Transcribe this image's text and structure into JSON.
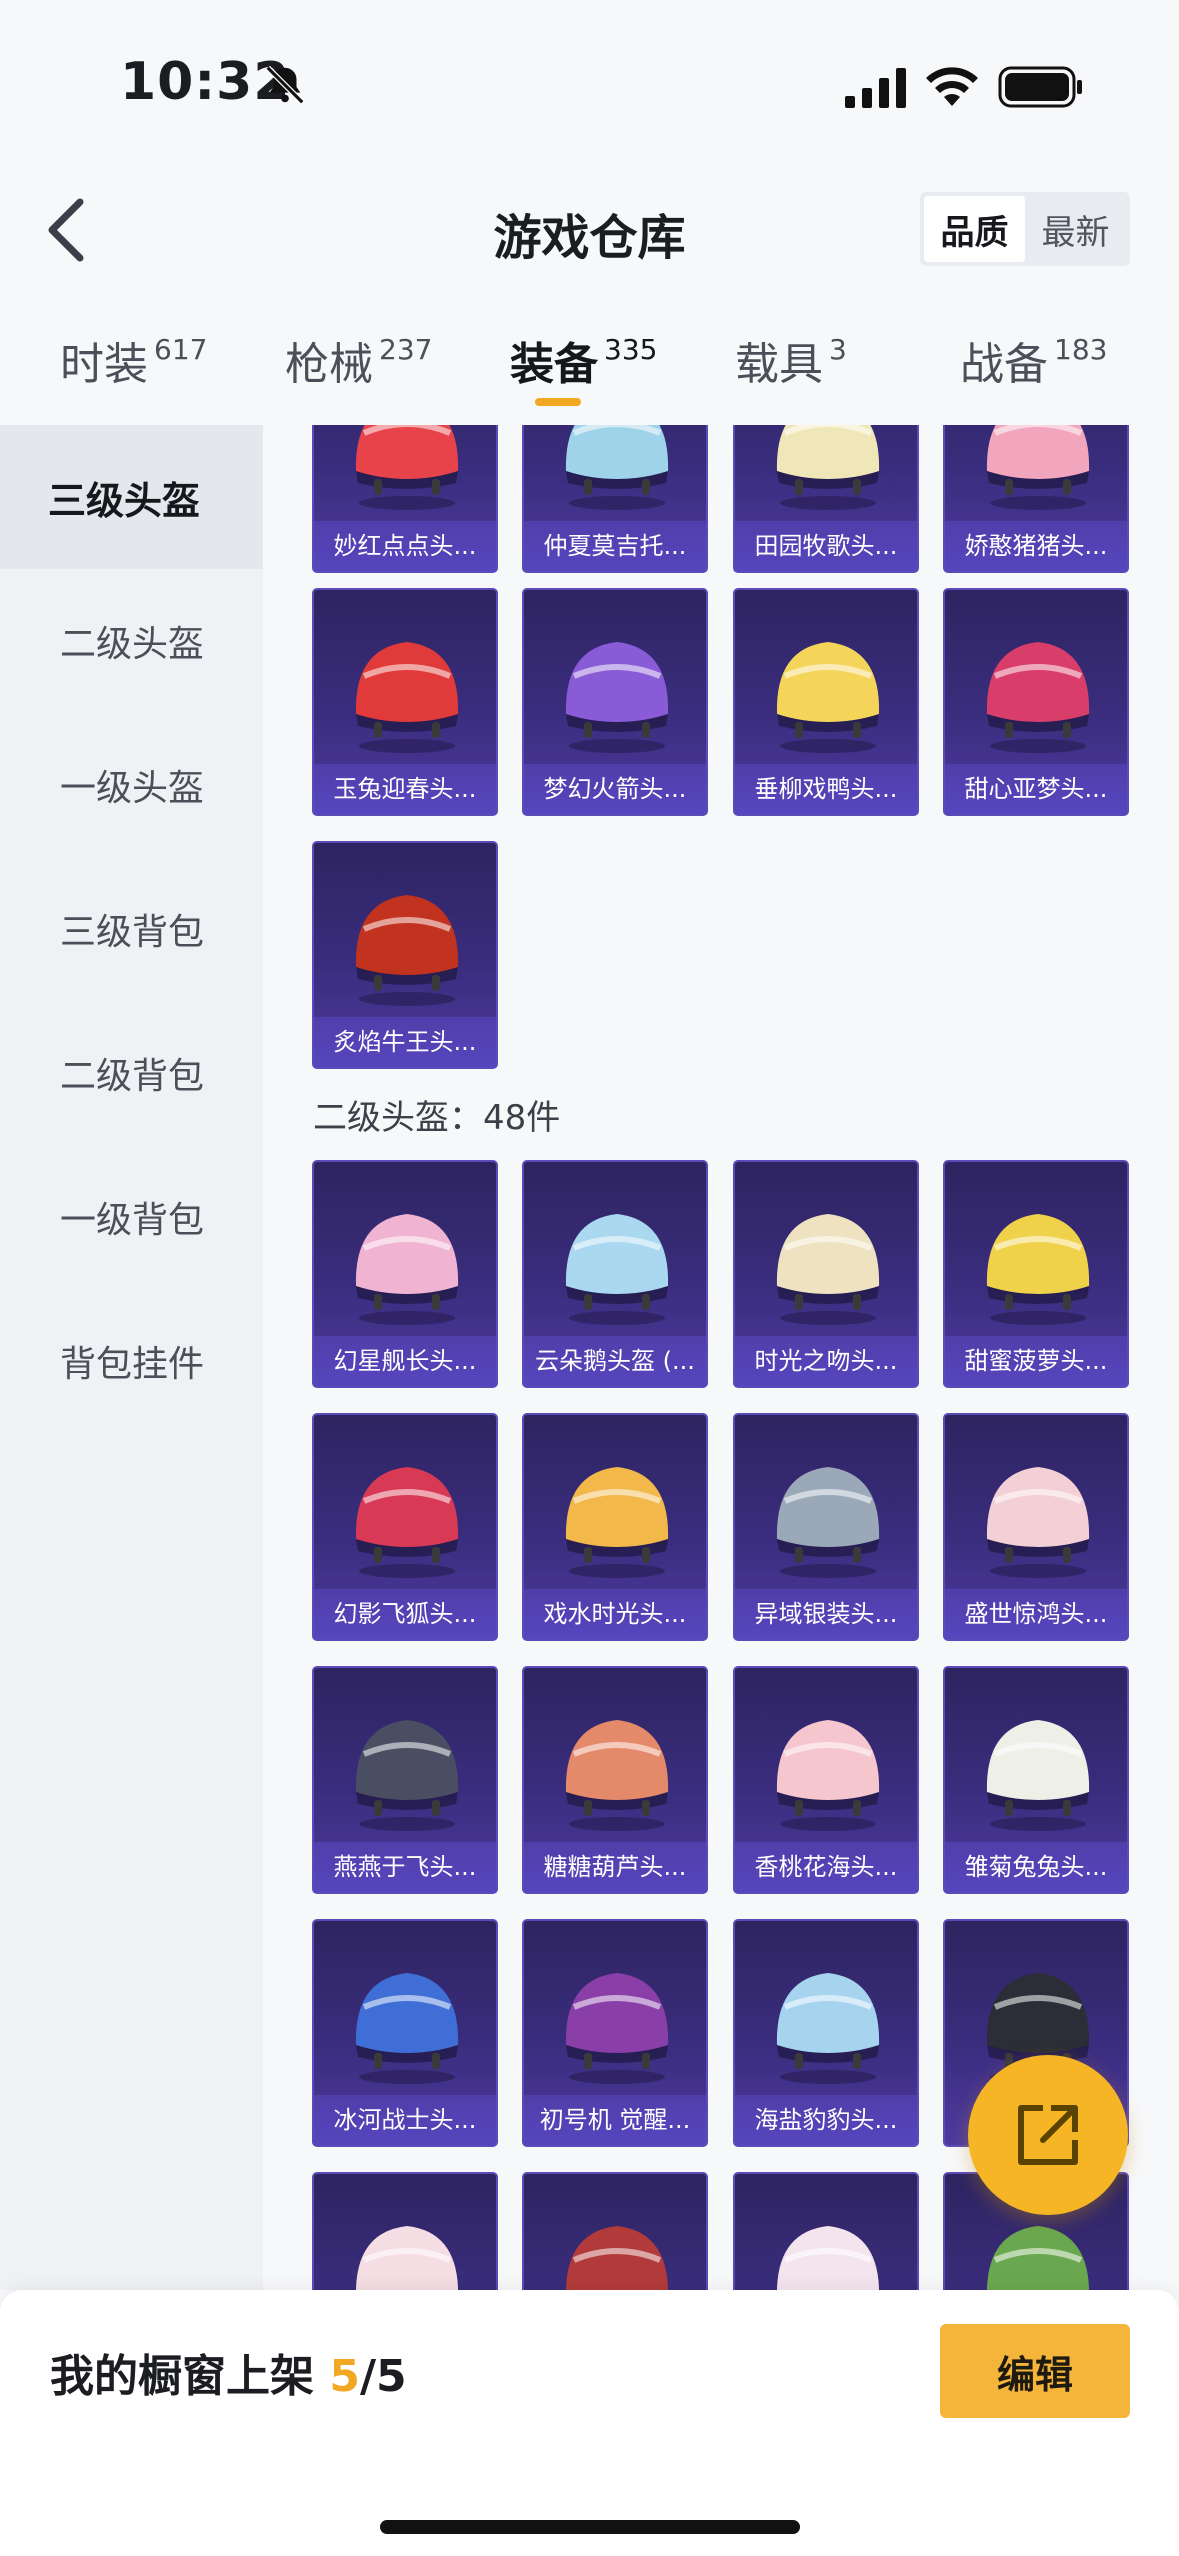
{
  "status_bar": {
    "time": "10:32"
  },
  "header": {
    "title": "游戏仓库",
    "sort_options": [
      "品质",
      "最新"
    ],
    "sort_selected": "品质"
  },
  "tabs": [
    {
      "label": "时装",
      "count": "617"
    },
    {
      "label": "枪械",
      "count": "237"
    },
    {
      "label": "装备",
      "count": "335",
      "active": true
    },
    {
      "label": "载具",
      "count": "3"
    },
    {
      "label": "战备",
      "count": "183"
    }
  ],
  "sidebar": [
    "三级头盔",
    "二级头盔",
    "一级头盔",
    "三级背包",
    "二级背包",
    "一级背包",
    "背包挂件"
  ],
  "sections": [
    {
      "heading": "",
      "items": [
        "妙红点点头...",
        "仲夏莫吉托...",
        "田园牧歌头...",
        "娇憨猪猪头...",
        "玉兔迎春头...",
        "梦幻火箭头...",
        "垂柳戏鸭头...",
        "甜心亚梦头...",
        "炙焰牛王头..."
      ]
    },
    {
      "heading": "二级头盔：48件",
      "items": [
        "幻星舰长头...",
        "云朵鹅头盔 (...",
        "时光之吻头...",
        "甜蜜菠萝头...",
        "幻影飞狐头...",
        "戏水时光头...",
        "异域银装头...",
        "盛世惊鸿头...",
        "燕燕于飞头...",
        "糖糖葫芦头...",
        "香桃花海头...",
        "雏菊兔兔头...",
        "冰河战士头...",
        "初号机 觉醒...",
        "海盐豹豹头...",
        "",
        "",
        "",
        "",
        ""
      ]
    }
  ],
  "helmet_colors": [
    [
      "#e8434a",
      "#9fd3ea",
      "#f0e7b8",
      "#f2a6bd"
    ],
    [
      "#e03a3a",
      "#8a5bd6",
      "#f4d55a",
      "#d93e6a"
    ],
    [
      "#c2331f"
    ],
    [
      "#f0b4d2",
      "#a9d8f0",
      "#efe2c0",
      "#f0d24a"
    ],
    [
      "#d83a55",
      "#f2b84a",
      "#9aa8b8",
      "#f3d0d6"
    ],
    [
      "#4a4e62",
      "#e48a6a",
      "#f6c6cf",
      "#eef0e8"
    ],
    [
      "#3f6fd6",
      "#8a3fa8",
      "#a6d4ef",
      "#2b2e36"
    ],
    [
      "#f5dde4",
      "#b23a3a",
      "#f4e4ee",
      "#6aa84f"
    ]
  ],
  "fab": {
    "icon": "share-icon"
  },
  "bottom_bar": {
    "label": "我的橱窗上架",
    "count_current": "5",
    "count_total": "/5",
    "edit_label": "编辑"
  }
}
